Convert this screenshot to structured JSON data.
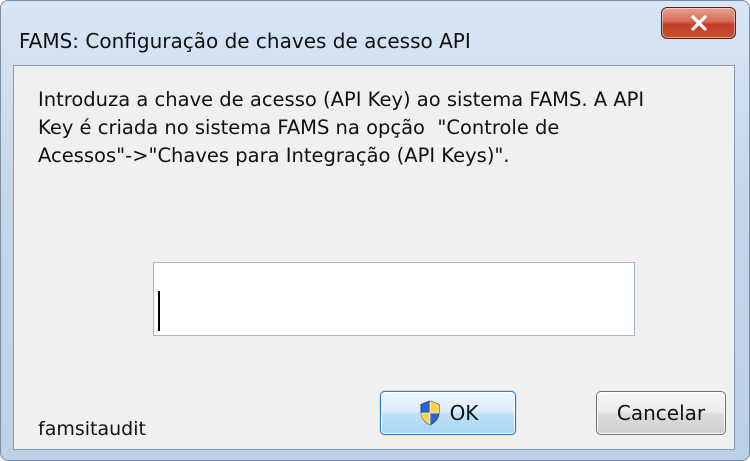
{
  "window": {
    "title": "FAMS: Configuração de chaves de acesso API"
  },
  "dialog": {
    "message": "Introduza a chave de acesso (API Key) ao sistema FAMS. A API\nKey é criada no sistema FAMS na opção  \"Controle de\nAcessos\"->\"Chaves para Integração (API Keys)\".",
    "api_key_input": {
      "value": "",
      "placeholder": ""
    },
    "footer_label": "famsitaudit",
    "buttons": {
      "ok_label": "OK",
      "cancel_label": "Cancelar"
    }
  },
  "icons": {
    "close": "close-icon",
    "shield": "shield-icon"
  },
  "colors": {
    "close_button": "#c9522f",
    "ok_button_border": "#2f7fc4",
    "window_frame": "#c4d6ea",
    "client_background": "#f0f0f0"
  }
}
